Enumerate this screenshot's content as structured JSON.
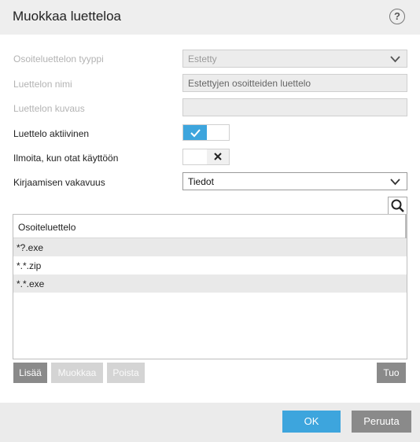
{
  "window": {
    "title": "Muokkaa luetteloa",
    "help_label": "?"
  },
  "form": {
    "list_type": {
      "label": "Osoiteluettelon tyyppi",
      "value": "Estetty"
    },
    "list_name": {
      "label": "Luettelon nimi",
      "value": "Estettyjen osoitteiden luettelo"
    },
    "list_desc": {
      "label": "Luettelon kuvaus",
      "value": ""
    },
    "list_active": {
      "label": "Luettelo aktiivinen",
      "checked": true
    },
    "notify": {
      "label": "Ilmoita, kun otat käyttöön",
      "checked": false
    },
    "log_severity": {
      "label": "Kirjaamisen vakavuus",
      "value": "Tiedot"
    }
  },
  "list": {
    "header": "Osoiteluettelo",
    "rows": [
      "*?.exe",
      "*.*.zip",
      "*.*.exe"
    ]
  },
  "list_buttons": {
    "add": "Lisää",
    "edit": "Muokkaa",
    "delete": "Poista",
    "import": "Tuo"
  },
  "footer": {
    "ok": "OK",
    "cancel": "Peruuta"
  },
  "colors": {
    "accent": "#3da5dd",
    "button_dark": "#8a8a8a",
    "button_disabled": "#d4d4d4"
  }
}
